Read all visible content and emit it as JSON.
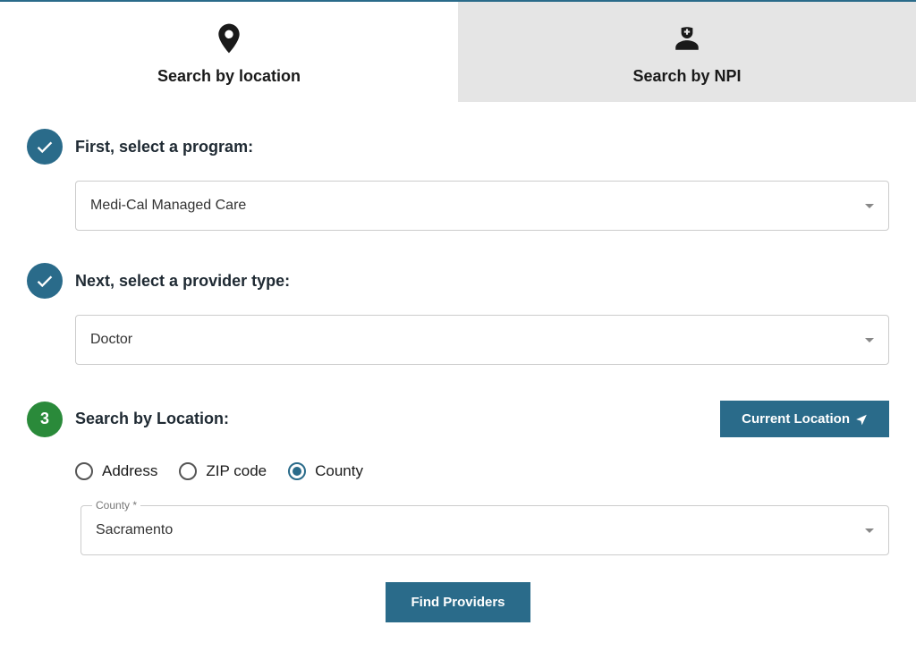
{
  "tabs": {
    "location": "Search by location",
    "npi": "Search by NPI"
  },
  "steps": {
    "program": {
      "label": "First, select a program:",
      "value": "Medi-Cal Managed Care"
    },
    "providerType": {
      "label": "Next, select a provider type:",
      "value": "Doctor"
    },
    "location": {
      "number": "3",
      "label": "Search by Location:",
      "currentLocationBtn": "Current Location",
      "radios": {
        "address": "Address",
        "zip": "ZIP code",
        "county": "County"
      },
      "countyField": {
        "label": "County *",
        "value": "Sacramento"
      }
    }
  },
  "submit": "Find Providers"
}
